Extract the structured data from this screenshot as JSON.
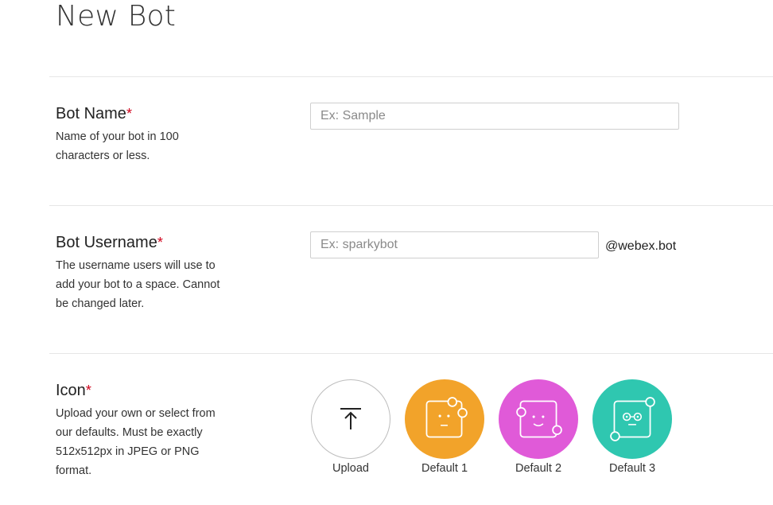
{
  "page": {
    "title": "New Bot"
  },
  "bot_name": {
    "title": "Bot Name",
    "required_mark": "*",
    "description": "Name of your bot in 100 characters or less.",
    "placeholder": "Ex: Sample",
    "value": ""
  },
  "bot_username": {
    "title": "Bot Username",
    "required_mark": "*",
    "description": "The username users will use to add your bot to a space. Cannot be changed later.",
    "placeholder": "Ex: sparkybot",
    "value": "",
    "suffix": "@webex.bot"
  },
  "icon": {
    "title": "Icon",
    "required_mark": "*",
    "description": "Upload your own or select from our defaults. Must be exactly 512x512px in JPEG or PNG format.",
    "options": [
      {
        "label": "Upload",
        "icon": "upload-icon"
      },
      {
        "label": "Default 1",
        "icon": "bot-face-icon",
        "color": "#f2a32a"
      },
      {
        "label": "Default 2",
        "icon": "bot-face-icon",
        "color": "#e05ad8"
      },
      {
        "label": "Default 3",
        "icon": "bot-face-icon",
        "color": "#2fc7b0"
      }
    ]
  }
}
